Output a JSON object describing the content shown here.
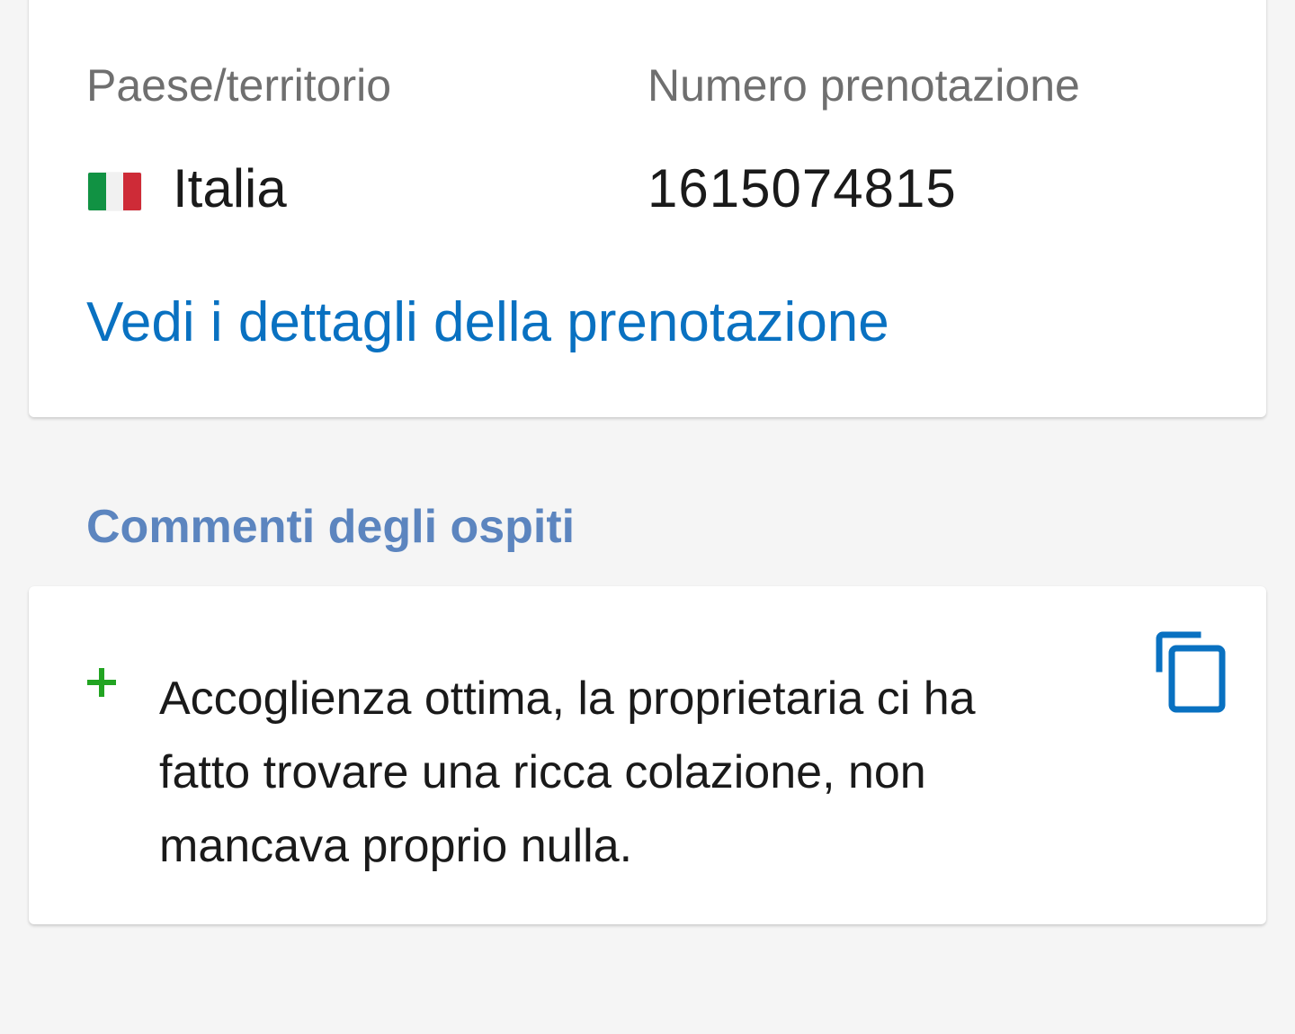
{
  "reservation": {
    "country_label": "Paese/territorio",
    "country_value": "Italia",
    "country_flag_icon": "italy-flag-icon",
    "booking_label": "Numero prenotazione",
    "booking_value": "1615074815",
    "details_link": "Vedi i dettagli della prenotazione"
  },
  "comments": {
    "section_title": "Commenti degli ospiti",
    "positive_icon": "plus-icon",
    "copy_icon": "copy-icon",
    "text": "Accoglienza ottima, la proprietaria ci ha fatto trovare una ricca colazione, non mancava proprio nulla."
  },
  "colors": {
    "background": "#f5f5f5",
    "card": "#ffffff",
    "link": "#0971c1",
    "section_title": "#5c85bf",
    "positive": "#22a422",
    "label": "#6f6f6f",
    "text": "#1a1a1a"
  }
}
